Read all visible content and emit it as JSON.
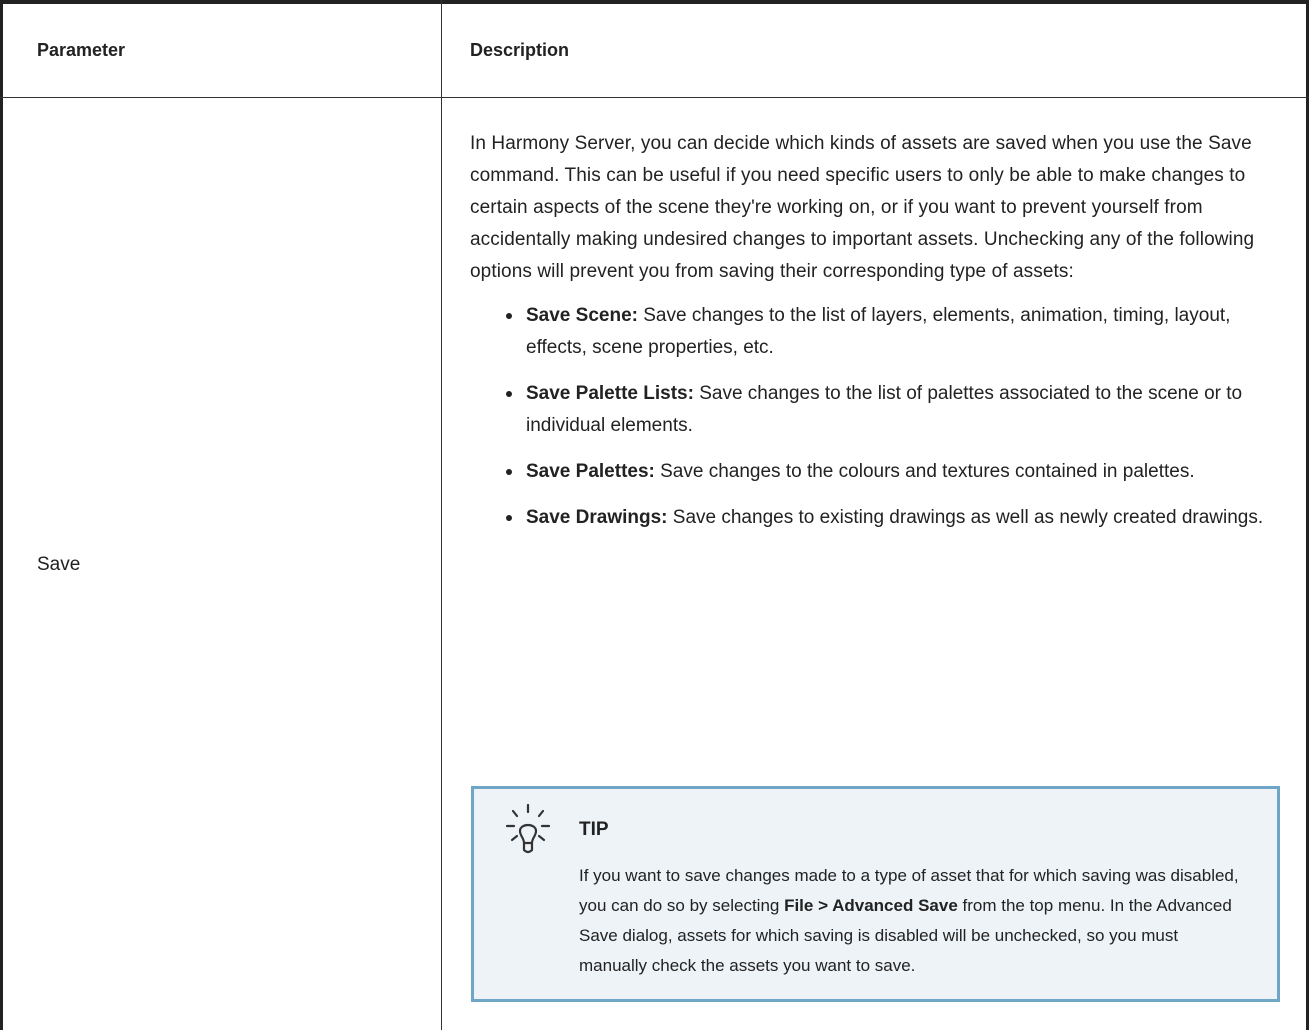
{
  "table": {
    "headers": {
      "parameter": "Parameter",
      "description": "Description"
    },
    "row": {
      "parameter": "Save",
      "intro": "In Harmony Server, you can decide which kinds of assets are saved when you use the Save command. This can be useful if you need specific users to only be able to make changes to certain aspects of the scene they're working on, or if you want to prevent yourself from accidentally making undesired changes to important assets. Unchecking any of the following options will prevent you from saving their corresponding type of assets:",
      "bullets": [
        {
          "term": "Save Scene:",
          "text": " Save changes to the list of layers, elements, animation, timing, layout, effects, scene properties, etc."
        },
        {
          "term": "Save Palette Lists:",
          "text": " Save changes to the list of palettes associated to the scene or to individual elements."
        },
        {
          "term": "Save Palettes:",
          "text": " Save changes to the colours and textures contained in palettes."
        },
        {
          "term": "Save Drawings:",
          "text": " Save changes to existing drawings as well as newly created drawings."
        }
      ],
      "tip": {
        "icon": "lightbulb-icon",
        "title": "TIP",
        "text_before": "If you want to save changes made to a type of asset that for which saving was disabled, you can do so by selecting ",
        "menu_path": "File > Advanced Save",
        "text_after": " from the top menu. In the Advanced Save dialog, assets for which saving is disabled will be unchecked, so you must manually check the assets you want to save."
      }
    }
  },
  "colors": {
    "tip_border": "#6fa5c6",
    "tip_background": "#eef3f7",
    "text": "#222222"
  }
}
